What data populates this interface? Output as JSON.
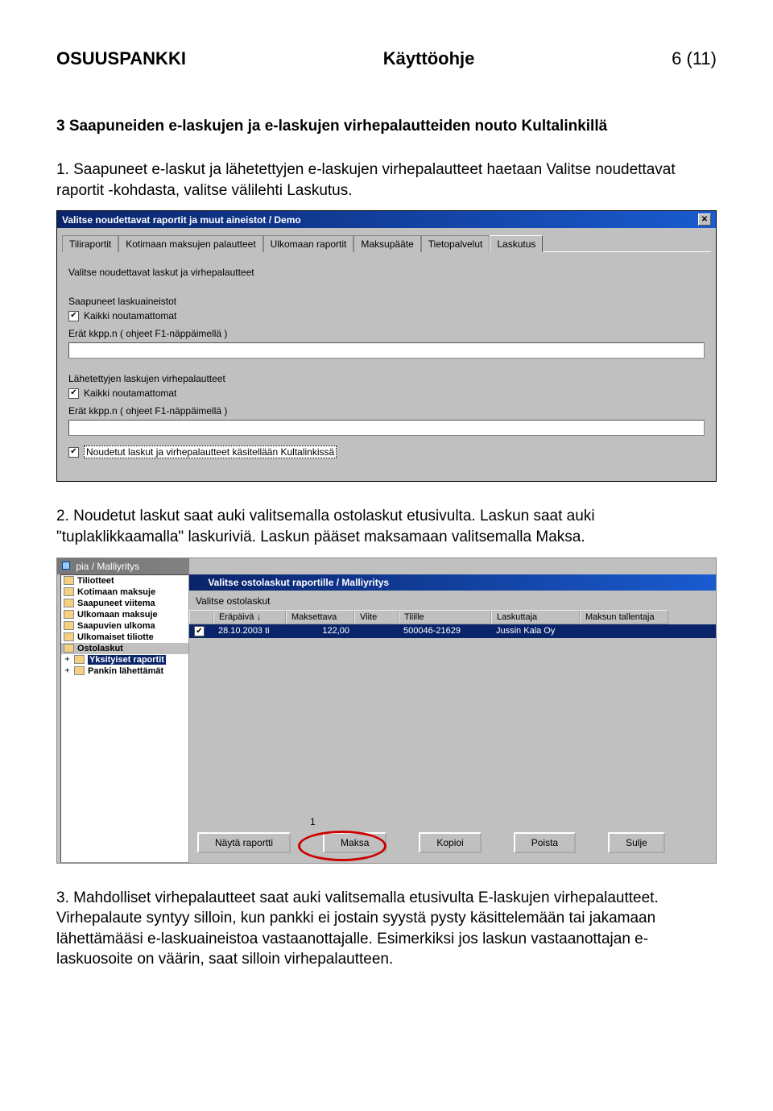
{
  "header": {
    "left": "OSUUSPANKKI",
    "center": "Käyttöohje",
    "right": "6 (11)"
  },
  "section3": {
    "title": "3 Saapuneiden e-laskujen ja e-laskujen virhepalautteiden nouto Kultalinkillä",
    "step1": "1. Saapuneet e-laskut ja lähetettyjen e-laskujen virhepalautteet haetaan Valitse noudettavat raportit -kohdasta, valitse välilehti Laskutus."
  },
  "dlg1": {
    "title": "Valitse noudettavat raportit ja muut aineistot / Demo",
    "tabs": [
      "Tiliraportit",
      "Kotimaan maksujen palautteet",
      "Ulkomaan raportit",
      "Maksupääte",
      "Tietopalvelut",
      "Laskutus"
    ],
    "heading": "Valitse noudettavat laskut ja virhepalautteet",
    "grp1_title": "Saapuneet laskuaineistot",
    "grp1_chk": "Kaikki noutamattomat",
    "grp1_lbl": "Erät kkpp.n ( ohjeet F1-näppäimellä )",
    "grp2_title": "Lähetettyjen laskujen virhepalautteet",
    "grp2_chk": "Kaikki noutamattomat",
    "grp2_lbl": "Erät kkpp.n ( ohjeet F1-näppäimellä )",
    "grp3_chk": "Noudetut laskut ja virhepalautteet käsitellään Kultalinkissä"
  },
  "step2": "2. Noudetut laskut saat auki valitsemalla ostolaskut etusivulta. Laskun saat auki \"tuplaklikkaamalla\" laskuriviä. Laskun pääset maksamaan valitsemalla Maksa.",
  "dlg2": {
    "apptitle": "pia / Malliyritys",
    "tree": [
      "Tiliotteet",
      "Kotimaan maksuje",
      "Saapuneet viitema",
      "Ulkomaan maksuje",
      "Saapuvien ulkoma",
      "Ulkomaiset tiliotte",
      "Ostolaskut",
      "Yksityiset raportit",
      "Pankin lähettämät"
    ],
    "wintitle": "Valitse ostolaskut raportille / Malliyritys",
    "sub": "Valitse ostolaskut",
    "cols": [
      "Eräpäivä ↓",
      "Maksettava",
      "Viite",
      "Tilille",
      "Laskuttaja",
      "Maksun tallentaja"
    ],
    "row": {
      "chk": "✔",
      "date": "28.10.2003 ti",
      "amt": "122,00",
      "viite": "",
      "tilille": "500046-21629",
      "laskuttaja": "Jussin Kala Oy",
      "tallentaja": ""
    },
    "page": "1",
    "buttons": [
      "Näytä raportti",
      "Maksa",
      "Kopioi",
      "Poista",
      "Sulje"
    ]
  },
  "step3": "3. Mahdolliset virhepalautteet saat auki valitsemalla etusivulta E-laskujen virhepalautteet. Virhepalaute syntyy silloin, kun pankki ei jostain syystä pysty käsittelemään tai jakamaan lähettämääsi e-laskuaineistoa vastaanottajalle. Esimerkiksi jos laskun vastaanottajan e-laskuosoite on väärin, saat silloin virhepalautteen."
}
